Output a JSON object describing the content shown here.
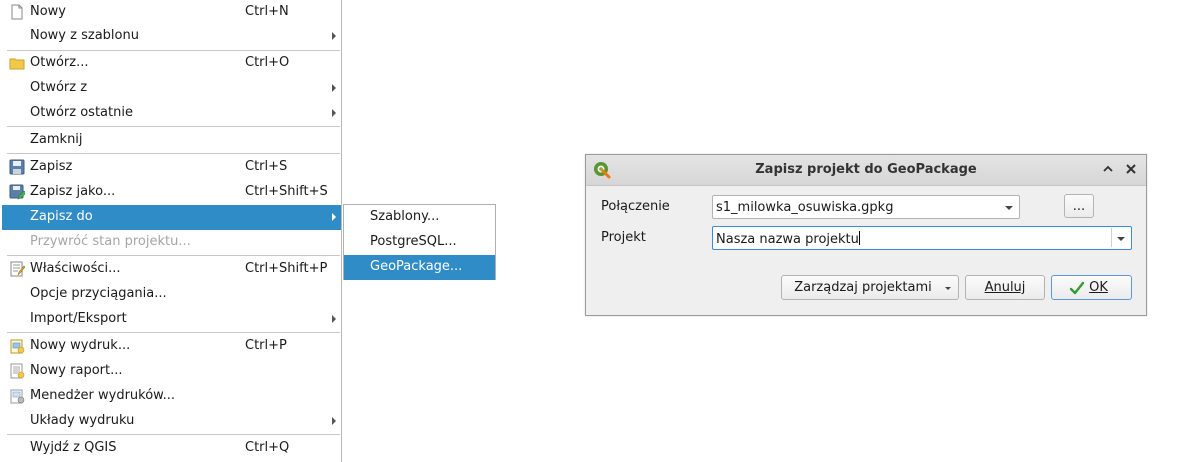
{
  "menu": {
    "new": {
      "label": "Nowy",
      "shortcut": "Ctrl+N"
    },
    "new_from_template": {
      "label": "Nowy z szablonu"
    },
    "open": {
      "label": "Otwórz...",
      "shortcut": "Ctrl+O"
    },
    "open_from": {
      "label": "Otwórz z"
    },
    "open_recent": {
      "label": "Otwórz ostatnie"
    },
    "close": {
      "label": "Zamknij"
    },
    "save": {
      "label": "Zapisz",
      "shortcut": "Ctrl+S"
    },
    "save_as": {
      "label": "Zapisz jako...",
      "shortcut": "Ctrl+Shift+S"
    },
    "save_to": {
      "label": "Zapisz do"
    },
    "revert": {
      "label": "Przywróć stan projektu..."
    },
    "properties": {
      "label": "Właściwości...",
      "shortcut": "Ctrl+Shift+P"
    },
    "snapping": {
      "label": "Opcje przyciągania..."
    },
    "import_export": {
      "label": "Import/Eksport"
    },
    "new_layout": {
      "label": "Nowy wydruk...",
      "shortcut": "Ctrl+P"
    },
    "new_report": {
      "label": "Nowy raport..."
    },
    "layout_manager": {
      "label": "Menedżer wydruków..."
    },
    "layouts": {
      "label": "Układy wydruku"
    },
    "exit": {
      "label": "Wyjdź z QGIS",
      "shortcut": "Ctrl+Q"
    }
  },
  "submenu": {
    "templates": "Szablony...",
    "postgresql": "PostgreSQL...",
    "geopackage": "GeoPackage..."
  },
  "dialog": {
    "title": "Zapisz projekt do GeoPackage",
    "connection_label": "Połączenie",
    "connection_value": "s1_milowka_osuwiska.gpkg",
    "browse_label": "...",
    "project_label": "Projekt",
    "project_value": "Nasza nazwa projektu",
    "manage_label": "Zarządzaj projektami",
    "cancel_label": "Anuluj",
    "ok_label": "OK"
  },
  "colors": {
    "highlight": "#308cc6",
    "disabled_text": "#a6a6a6",
    "dialog_bg": "#efefef"
  },
  "icons": {
    "new": "file-icon",
    "open": "folder-icon",
    "save": "floppy-icon",
    "save_as": "floppy-edit-icon",
    "properties": "properties-icon",
    "new_layout": "new-layout-icon",
    "new_report": "new-report-icon",
    "layout_manager": "layout-manager-icon",
    "dialog_logo": "qgis-logo-icon",
    "ok": "checkmark-icon"
  }
}
